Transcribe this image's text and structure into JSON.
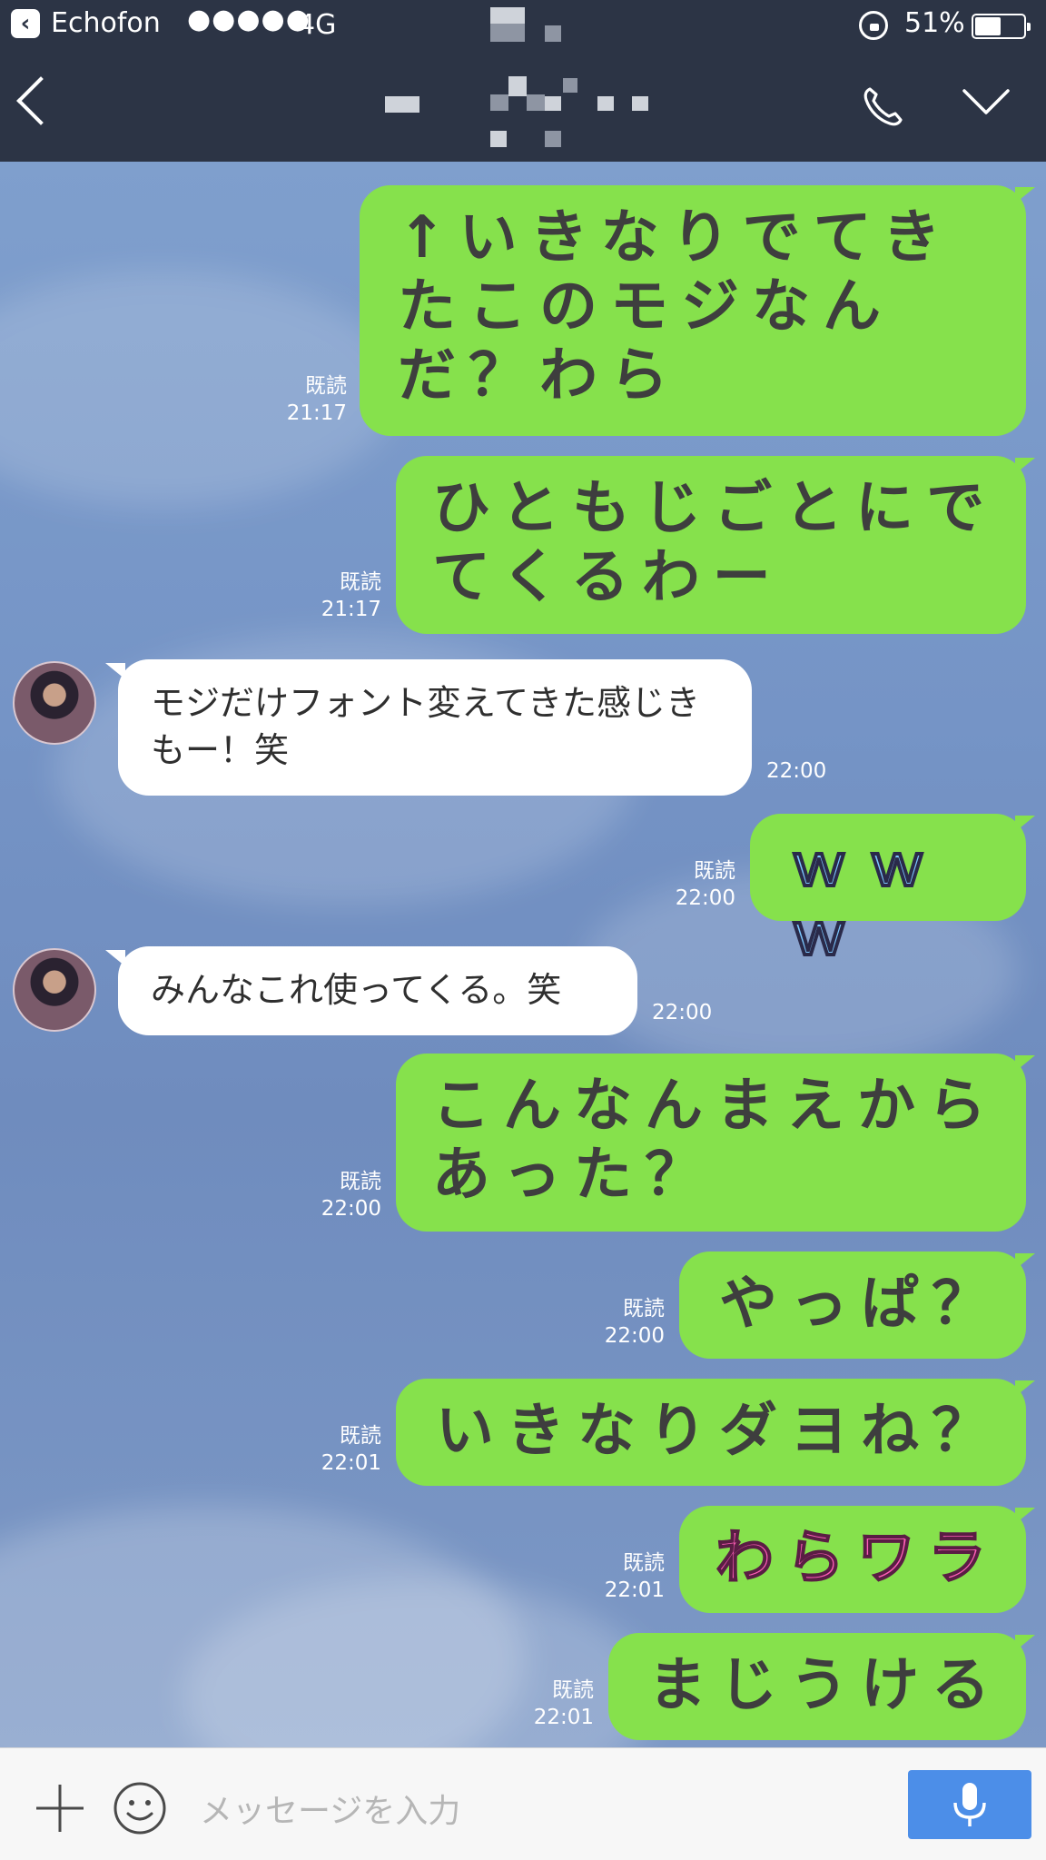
{
  "status_bar": {
    "app_name": "Echofon",
    "signal": "●●●●●",
    "network": "4G",
    "battery": "51%"
  },
  "footer": {
    "placeholder": "メッセージを入力"
  },
  "messages": [
    {
      "text": "↑いきなりでてきたこのモジなんだ？わら",
      "read": "既読",
      "time": "21:17"
    },
    {
      "text": "ひともじごとにでてくるわー",
      "read": "既読",
      "time": "21:17"
    },
    {
      "text": "モジだけフォント変えてきた感じきもー！笑",
      "time": "22:00"
    },
    {
      "text": "ｗｗｗ",
      "read": "既読",
      "time": "22:00"
    },
    {
      "text": "みんなこれ使ってくる。笑",
      "time": "22:00"
    },
    {
      "text": "こんなんまえからあった？",
      "read": "既読",
      "time": "22:00"
    },
    {
      "text": "やっぱ？",
      "read": "既読",
      "time": "22:00"
    },
    {
      "text": "いきなりダヨね？",
      "read": "既読",
      "time": "22:01"
    },
    {
      "text": "わらワラ",
      "read": "既読",
      "time": "22:01"
    },
    {
      "text": "まじうける",
      "read": "既読",
      "time": "22:01"
    }
  ]
}
